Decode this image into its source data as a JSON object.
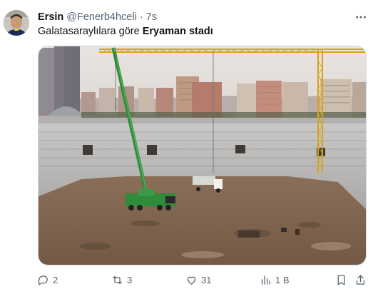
{
  "author": {
    "name": "Ersin",
    "handle": "@Fenerb4hceli",
    "separator": "·",
    "time": "7s"
  },
  "tweet": {
    "text_prefix": "Galatasaraylılara göre ",
    "text_bold": "Eryaman stadı"
  },
  "actions": {
    "replies": "2",
    "retweets": "3",
    "likes": "31",
    "views": "1 B"
  },
  "icons": {
    "more": "more-horizontal-icon",
    "reply": "reply-icon",
    "retweet": "retweet-icon",
    "like": "heart-icon",
    "views": "views-chart-icon",
    "bookmark": "bookmark-icon",
    "share": "share-icon"
  },
  "colors": {
    "text": "#0f1419",
    "secondary": "#536471",
    "border": "#cfd9de",
    "crane": "#2e8b3a",
    "tower_crane": "#d9a21b"
  }
}
